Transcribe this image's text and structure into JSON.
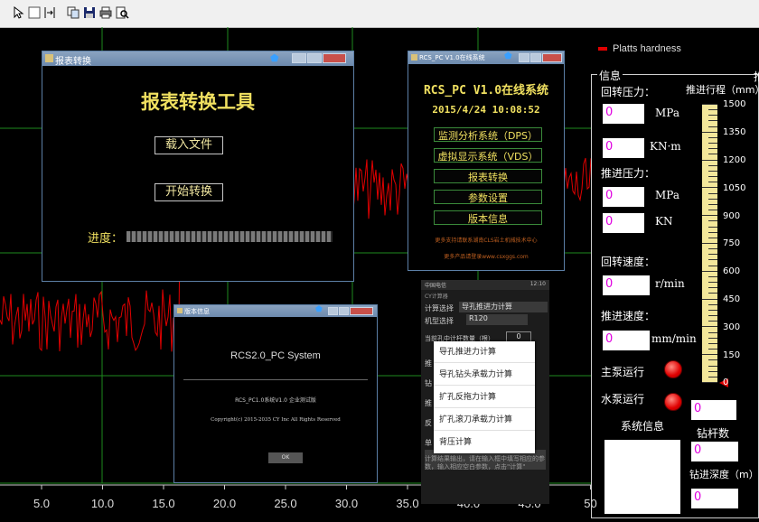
{
  "toolbar": {
    "icons": [
      "pointer-icon",
      "select-box-icon",
      "fit-icon",
      "copy-icon",
      "save-icon",
      "print-icon",
      "print-preview-icon"
    ]
  },
  "chart": {
    "legend_label": "Platts hardness",
    "legend_color": "#e00000",
    "grid_color": "#1e8a1e",
    "x_ticks": [
      "5.0",
      "10.0",
      "15.0",
      "20.0",
      "25.0",
      "30.0",
      "35.0",
      "40.0",
      "45.0",
      "50"
    ]
  },
  "report_window": {
    "title": "报表转换",
    "heading": "报表转换工具",
    "load_button": "载入文件",
    "start_button": "开始转换",
    "progress_label": "进度：",
    "progress": 0
  },
  "rcs_window": {
    "title": "RCS_PC V1.0在线系统",
    "app_name": "RCS_PC V1.0在线系统",
    "datetime": "2015/4/24 10:08:52",
    "menu": [
      "监测分析系统（DPS）",
      "虚拟显示系统（VDS）",
      "报表转换",
      "参数设置",
      "版本信息"
    ],
    "footer1": "更多支持请联系湖南CLS岩土机械技术中心",
    "footer2": "更多产品请登录www.csxggs.com"
  },
  "version_window": {
    "title": "版本信息",
    "system_name": "RCS2.0_PC System",
    "line1": "RCS_PC1.0系统V1.0 企业测试版",
    "line2": "Copyright(c) 2015-2035 CY Inc All Rights Reserved",
    "ok_button": "OK"
  },
  "phone": {
    "status_left": "中国电信",
    "status_right": "12:10",
    "app_title": "CY计算器",
    "row1_label": "计算选择",
    "row1_value": "导孔推进力计算",
    "row2_label": "机型选择",
    "row2_value": "R120",
    "row3_label": "当前孔中计杆数量（根）",
    "row3_value": "0",
    "dropdown": [
      "导孔推进力计算",
      "导孔钻头承载力计算",
      "扩孔反拖力计算",
      "扩孔滚刀承载力计算",
      "背压计算"
    ],
    "left_stub": [
      "推",
      "钻",
      "推",
      "反",
      "单"
    ],
    "result_text": "计算结果输出，请在输入框中填写相应的参数，输入相应空白参数，点击\"计算\""
  },
  "info_panel": {
    "group_title": "信息",
    "group_title2": "推",
    "rotation_pressure_label": "回转压力：",
    "rotation_pressure_value": "0",
    "rotation_pressure_unit": "MPa",
    "rotation_torque_value": "0",
    "rotation_torque_unit": "KN·m",
    "push_pressure_label": "推进压力：",
    "push_pressure_value": "0",
    "push_pressure_unit": "MPa",
    "push_force_value": "0",
    "push_force_unit": "KN",
    "rotation_speed_label": "回转速度：",
    "rotation_speed_value": "0",
    "rotation_speed_unit": "r/min",
    "push_speed_label": "推进速度：",
    "push_speed_value": "0",
    "push_speed_unit": "mm/min",
    "main_pump_label": "主泵运行",
    "water_pump_label": "水泵运行",
    "system_info_label": "系统信息",
    "stroke_label": "推进行程（mm）",
    "stroke_scale": [
      "1500",
      "1350",
      "1200",
      "1050",
      "900",
      "750",
      "600",
      "450",
      "300",
      "150",
      "0"
    ],
    "stroke_value": "0",
    "rod_count_label": "钻杆数",
    "rod_count_value": "0",
    "drill_depth_label": "钻进深度（m）",
    "drill_depth_value": "0"
  }
}
